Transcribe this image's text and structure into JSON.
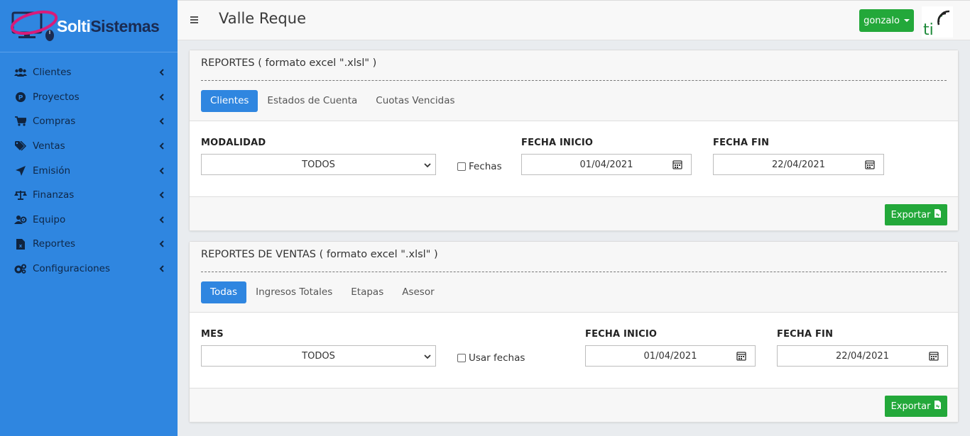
{
  "brand": {
    "name_part1": "Solti",
    "name_part2": "Sistemas"
  },
  "sidebar": {
    "items": [
      {
        "label": "Clientes",
        "icon": "users-icon"
      },
      {
        "label": "Proyectos",
        "icon": "parking-icon"
      },
      {
        "label": "Compras",
        "icon": "cart-icon"
      },
      {
        "label": "Ventas",
        "icon": "tags-icon"
      },
      {
        "label": "Emisión",
        "icon": "paper-plane-icon"
      },
      {
        "label": "Finanzas",
        "icon": "balance-scale-icon"
      },
      {
        "label": "Equipo",
        "icon": "team-icon"
      },
      {
        "label": "Reportes",
        "icon": "excel-file-icon"
      },
      {
        "label": "Configuraciones",
        "icon": "cogs-icon"
      }
    ]
  },
  "topbar": {
    "title": "Valle Reque",
    "user": "gonzalo"
  },
  "card1": {
    "title": "REPORTES ( formato excel \".xlsl\" )",
    "tabs": [
      {
        "label": "Clientes",
        "active": true
      },
      {
        "label": "Estados de Cuenta",
        "active": false
      },
      {
        "label": "Cuotas Vencidas",
        "active": false
      }
    ],
    "modalidad_label": "MODALIDAD",
    "modalidad_value": "TODOS",
    "checkbox_label": "Fechas",
    "fecha_inicio_label": "FECHA INICIO",
    "fecha_inicio_value": "01/04/2021",
    "fecha_fin_label": "FECHA FIN",
    "fecha_fin_value": "22/04/2021",
    "export_label": "Exportar"
  },
  "card2": {
    "title": "REPORTES DE VENTAS ( formato excel \".xlsl\" )",
    "tabs": [
      {
        "label": "Todas",
        "active": true
      },
      {
        "label": "Ingresos Totales",
        "active": false
      },
      {
        "label": "Etapas",
        "active": false
      },
      {
        "label": "Asesor",
        "active": false
      }
    ],
    "mes_label": "MES",
    "mes_value": "TODOS",
    "checkbox_label": "Usar fechas",
    "fecha_inicio_label": "FECHA INICIO",
    "fecha_inicio_value": "01/04/2021",
    "fecha_fin_label": "FECHA FIN",
    "fecha_fin_value": "22/04/2021",
    "export_label": "Exportar"
  },
  "colors": {
    "sidebar": "#2f86e0",
    "primary": "#2f86e0",
    "success": "#23a83a",
    "brand_dark": "#1a2b52"
  }
}
